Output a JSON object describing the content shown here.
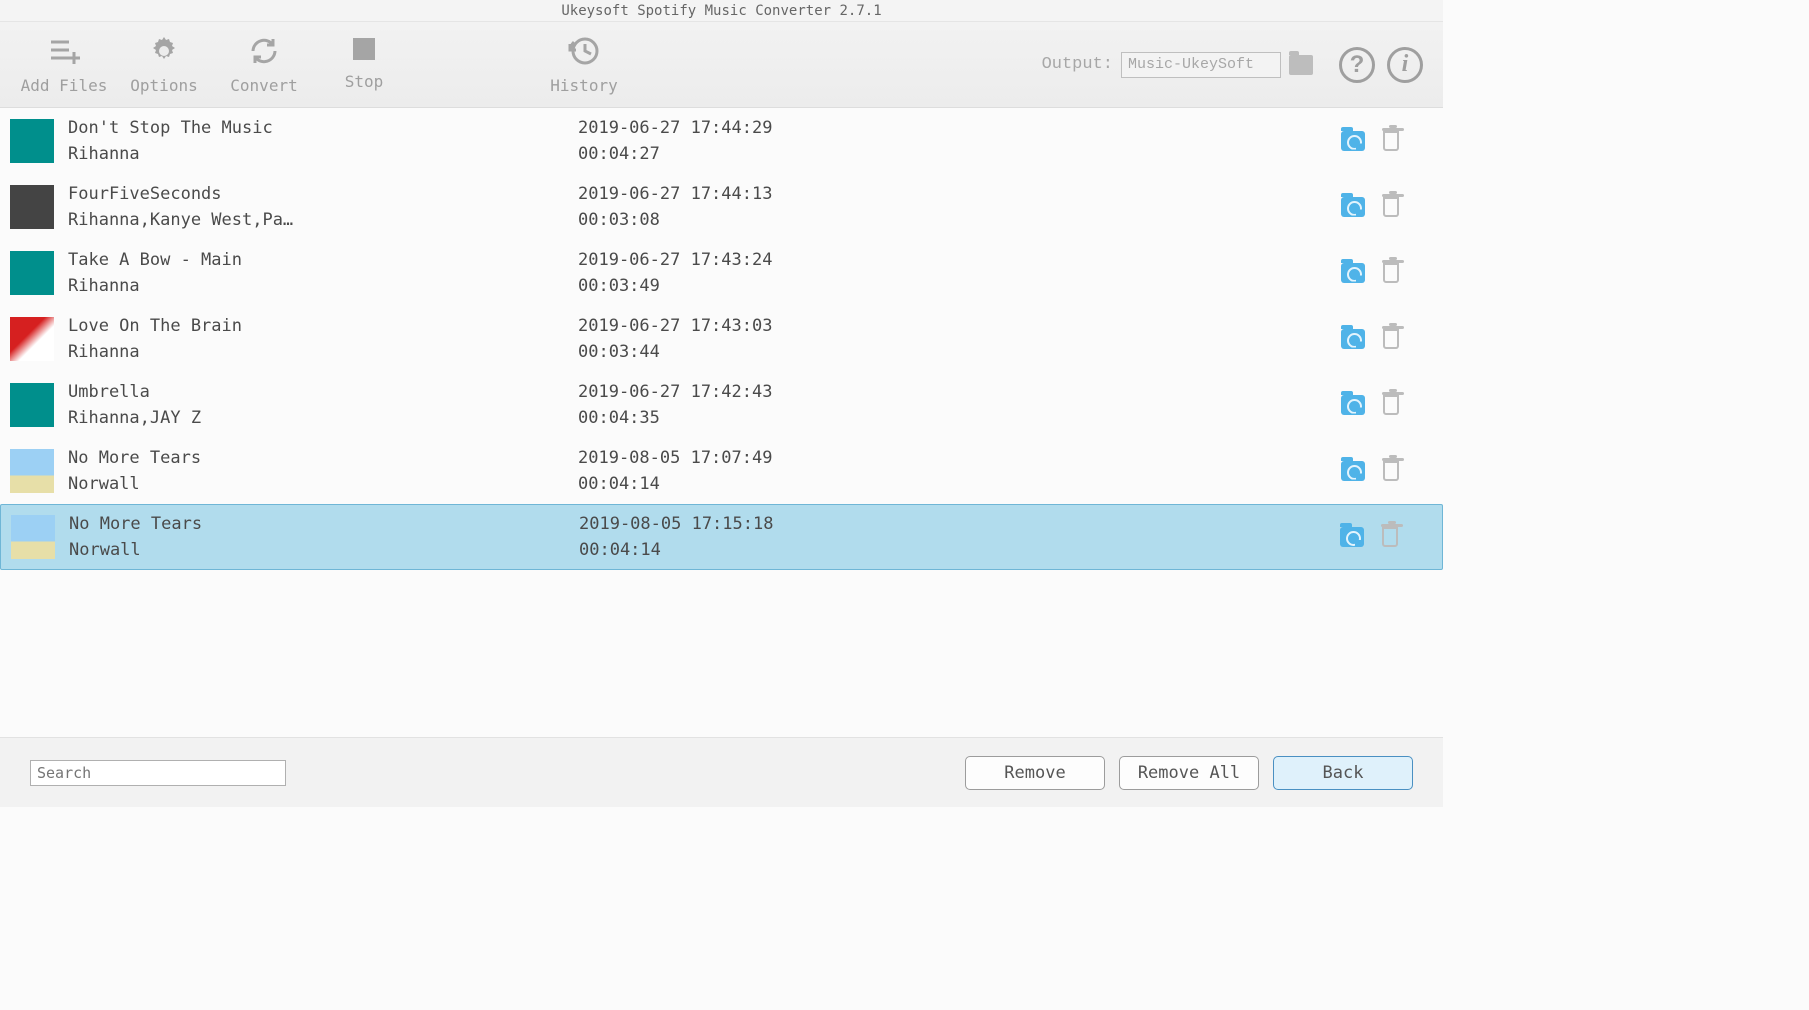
{
  "window": {
    "title": "Ukeysoft Spotify Music Converter 2.7.1"
  },
  "toolbar": {
    "add_files": "Add Files",
    "options": "Options",
    "convert": "Convert",
    "stop": "Stop",
    "history": "History"
  },
  "output": {
    "label": "Output:",
    "value": "Music-UkeySoft"
  },
  "tracks": [
    {
      "title": "Don't Stop The Music",
      "artist": "Rihanna",
      "date": "2019-06-27 17:44:29",
      "duration": "00:04:27",
      "cover": "cov-teal",
      "selected": false
    },
    {
      "title": "FourFiveSeconds",
      "artist": "Rihanna,Kanye West,Pa…",
      "date": "2019-06-27 17:44:13",
      "duration": "00:03:08",
      "cover": "cov-group",
      "selected": false
    },
    {
      "title": "Take A Bow - Main",
      "artist": "Rihanna",
      "date": "2019-06-27 17:43:24",
      "duration": "00:03:49",
      "cover": "cov-teal",
      "selected": false
    },
    {
      "title": "Love On The Brain",
      "artist": "Rihanna",
      "date": "2019-06-27 17:43:03",
      "duration": "00:03:44",
      "cover": "cov-anti",
      "selected": false
    },
    {
      "title": "Umbrella",
      "artist": "Rihanna,JAY Z",
      "date": "2019-06-27 17:42:43",
      "duration": "00:04:35",
      "cover": "cov-teal",
      "selected": false
    },
    {
      "title": "No More Tears",
      "artist": "Norwall",
      "date": "2019-08-05 17:07:49",
      "duration": "00:04:14",
      "cover": "cov-beach",
      "selected": false
    },
    {
      "title": "No More Tears",
      "artist": "Norwall",
      "date": "2019-08-05 17:15:18",
      "duration": "00:04:14",
      "cover": "cov-beach",
      "selected": true
    }
  ],
  "footer": {
    "search_placeholder": "Search",
    "remove": "Remove",
    "remove_all": "Remove All",
    "back": "Back"
  }
}
